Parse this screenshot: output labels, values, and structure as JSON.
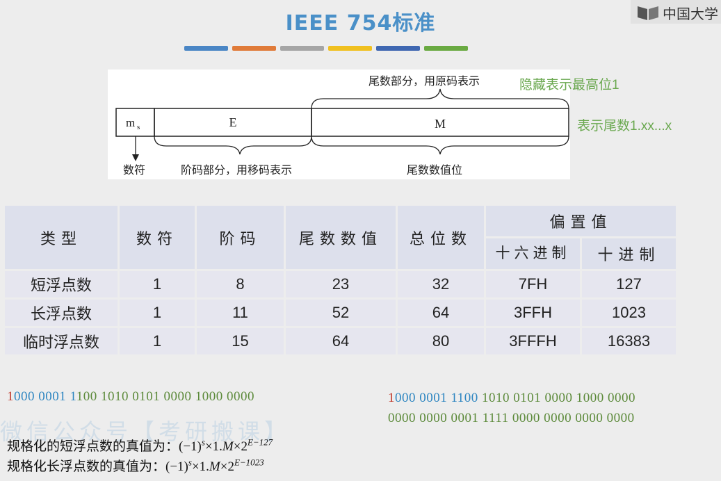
{
  "title": "IEEE 754标准",
  "logo": {
    "text": "中国大学",
    "icon": "book-icon"
  },
  "stripes": [
    "#4a86c5",
    "#e07b39",
    "#a5a5a5",
    "#f0c020",
    "#3f67b1",
    "#6aaa42"
  ],
  "diagram": {
    "cell_sign": "m",
    "cell_sign_sub": "s",
    "cell_exp": "E",
    "cell_mant": "M",
    "top_label": "尾数部分，用原码表示",
    "label_sign": "数符",
    "label_exp": "阶码部分，用移码表示",
    "label_mant": "尾数数值位"
  },
  "notes": {
    "hidden_bit": "隐藏表示最高位1",
    "mantissa_form": "表示尾数1.xx...x"
  },
  "table": {
    "headers": [
      "类型",
      "数符",
      "阶码",
      "尾数数值",
      "总位数"
    ],
    "bias_header": "偏置值",
    "bias_sub": [
      "十六进制",
      "十进制"
    ],
    "rows": [
      [
        "短浮点数",
        "1",
        "8",
        "23",
        "32",
        "7FH",
        "127"
      ],
      [
        "长浮点数",
        "1",
        "11",
        "52",
        "64",
        "3FFH",
        "1023"
      ],
      [
        "临时浮点数",
        "1",
        "15",
        "64",
        "80",
        "3FFFH",
        "16383"
      ]
    ]
  },
  "bits_left": {
    "sign": "1",
    "exp_a": "000 0001 1",
    "rest": "100 1010 0101 0000 1000 0000"
  },
  "bits_right": {
    "sign": "1",
    "exp_a": "000 0001 1100",
    "rest": " 1010 0101 0000 1000 0000",
    "line2": "0000 0000 0001 1111 0000 0000 0000 0000"
  },
  "watermark": "微信公众号【考研搬课】",
  "formula1": {
    "text": "规格化的短浮点数的真值为：(−1)",
    "exp_s": "s",
    "mid": "×1.",
    "m": "M",
    "tail": "×2",
    "exp": "E−127"
  },
  "formula2": {
    "text": "规格化长浮点数的真值为：(−1)",
    "exp_s": "s",
    "mid": "×1.",
    "m": "M",
    "tail": "×2",
    "exp": "E−1023"
  }
}
